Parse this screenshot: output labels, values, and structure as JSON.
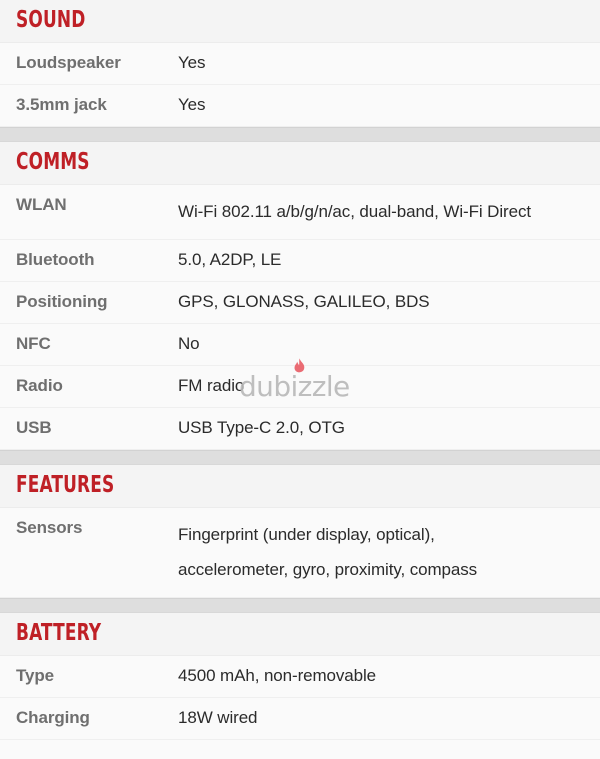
{
  "page": {
    "kind": "phone-specification-sheet",
    "background_color": "#fafafa",
    "accent_color": "#bf2026",
    "label_color": "#6f6f6f",
    "value_color": "#2b2b2b",
    "separator_band_color": "#dedede"
  },
  "watermark": {
    "text": "dubizzle",
    "icon": "flame-icon",
    "icon_color": "#e9636b",
    "text_color": "#b9b9b9"
  },
  "sections": [
    {
      "title": "SOUND",
      "leading_band": false,
      "rows": [
        {
          "label": "Loudspeaker",
          "value": "Yes",
          "multiline": false
        },
        {
          "label": "3.5mm jack",
          "value": "Yes",
          "multiline": false
        }
      ]
    },
    {
      "title": "COMMS",
      "leading_band": true,
      "rows": [
        {
          "label": "WLAN",
          "value": "Wi-Fi 802.11 a/b/g/n/ac, dual-band, Wi-Fi Direct",
          "multiline": true
        },
        {
          "label": "Bluetooth",
          "value": "5.0, A2DP, LE",
          "multiline": false
        },
        {
          "label": "Positioning",
          "value": "GPS, GLONASS, GALILEO, BDS",
          "multiline": false
        },
        {
          "label": "NFC",
          "value": "No",
          "multiline": false
        },
        {
          "label": "Radio",
          "value": "FM radio",
          "multiline": false
        },
        {
          "label": "USB",
          "value": "USB Type-C 2.0, OTG",
          "multiline": false
        }
      ]
    },
    {
      "title": "FEATURES",
      "leading_band": true,
      "rows": [
        {
          "label": "Sensors",
          "value": "Fingerprint (under display, optical), accelerometer, gyro, proximity, compass",
          "multiline": true
        }
      ]
    },
    {
      "title": "BATTERY",
      "leading_band": true,
      "rows": [
        {
          "label": "Type",
          "value": "4500 mAh, non-removable",
          "multiline": false
        },
        {
          "label": "Charging",
          "value": "18W wired",
          "multiline": false
        }
      ]
    }
  ]
}
